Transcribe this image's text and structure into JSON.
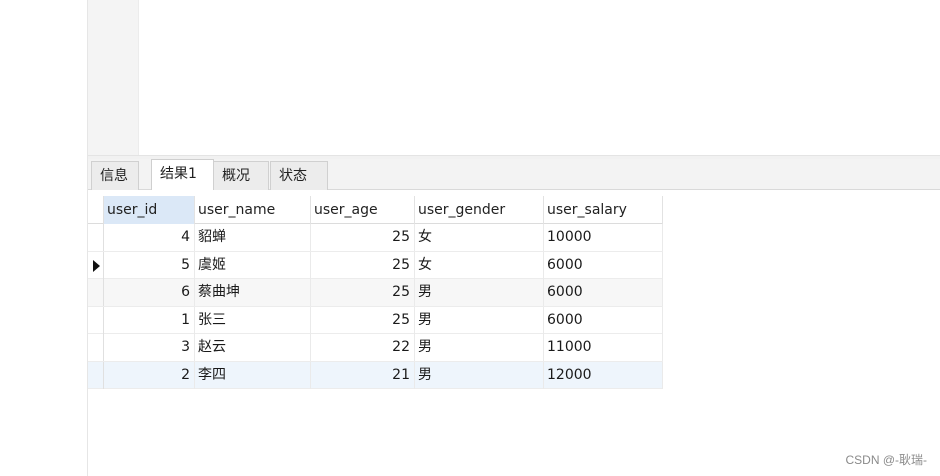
{
  "tabs": [
    {
      "label": "信息",
      "active": false
    },
    {
      "label": "结果1",
      "active": true
    },
    {
      "label": "概况",
      "active": false
    },
    {
      "label": "状态",
      "active": false
    }
  ],
  "grid": {
    "columns": [
      "user_id",
      "user_name",
      "user_age",
      "user_gender",
      "user_salary"
    ],
    "rows": [
      {
        "user_id": "4",
        "user_name": "貂蝉",
        "user_age": "25",
        "user_gender": "女",
        "user_salary": "10000"
      },
      {
        "user_id": "5",
        "user_name": "虞姬",
        "user_age": "25",
        "user_gender": "女",
        "user_salary": "6000"
      },
      {
        "user_id": "6",
        "user_name": "蔡曲坤",
        "user_age": "25",
        "user_gender": "男",
        "user_salary": "6000"
      },
      {
        "user_id": "1",
        "user_name": "张三",
        "user_age": "25",
        "user_gender": "男",
        "user_salary": "6000"
      },
      {
        "user_id": "3",
        "user_name": "赵云",
        "user_age": "22",
        "user_gender": "男",
        "user_salary": "11000"
      },
      {
        "user_id": "2",
        "user_name": "李四",
        "user_age": "21",
        "user_gender": "男",
        "user_salary": "12000"
      }
    ],
    "current_row_index": 1,
    "selected_column": "user_id"
  },
  "watermark": "CSDN @-耿瑞-",
  "colors": {
    "selected_header": "#dbe8f7",
    "row_alt": "#f7f7f7"
  }
}
